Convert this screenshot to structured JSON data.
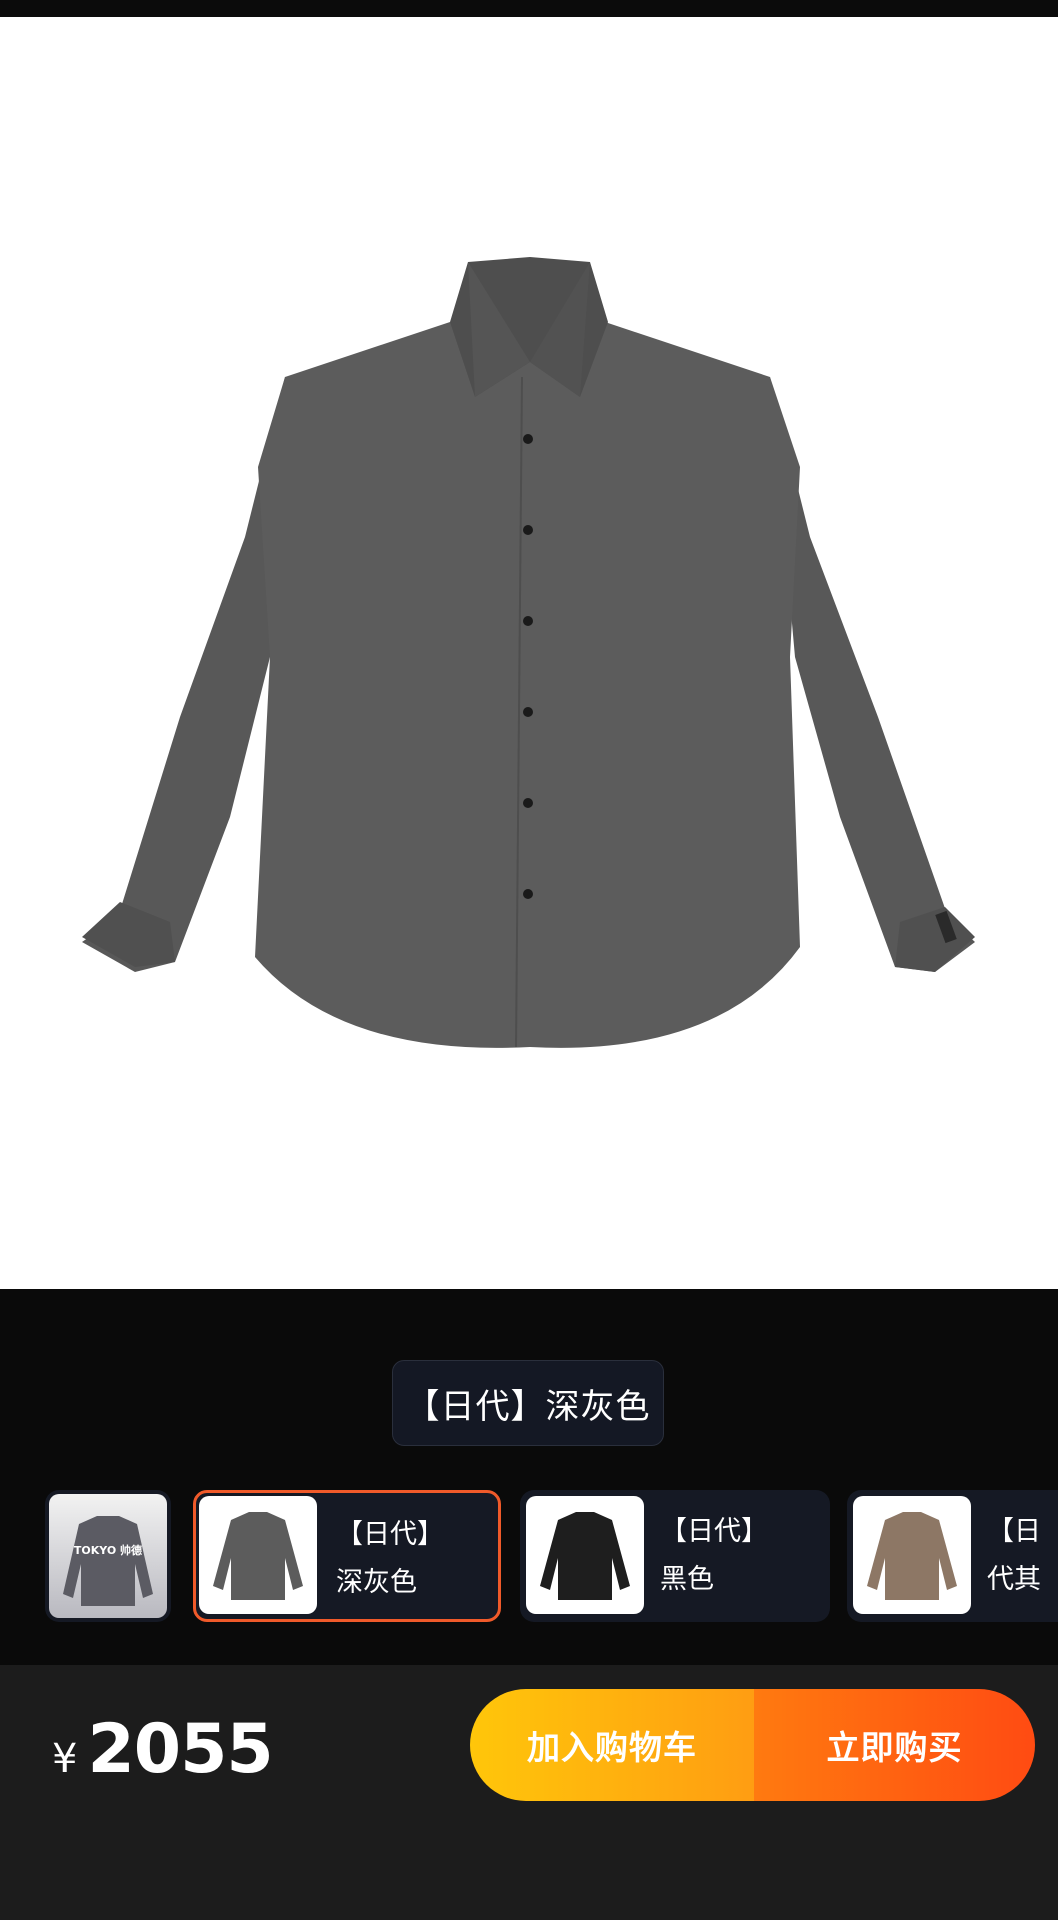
{
  "product": {
    "selected_variant_label": "【日代】深灰色"
  },
  "variants": [
    {
      "label": "",
      "logo_text": "TOKYO 帅德"
    },
    {
      "label": "【日代】深灰色",
      "selected": true
    },
    {
      "label": "【日代】黑色"
    },
    {
      "label": "【日代其"
    }
  ],
  "bottom_bar": {
    "currency": "¥",
    "price": "2055",
    "add_to_cart_label": "加入购物车",
    "buy_now_label": "立即购买"
  },
  "colors": {
    "shirt_dark_gray": "#5a5a5a",
    "shirt_black": "#1e1e1e",
    "shirt_khaki": "#8d7765",
    "accent_orange": "#f05a2a",
    "cart_gradient": [
      "#ffc60a",
      "#ff9d12"
    ],
    "buy_gradient": [
      "#ff7a10",
      "#ff4b12"
    ]
  }
}
